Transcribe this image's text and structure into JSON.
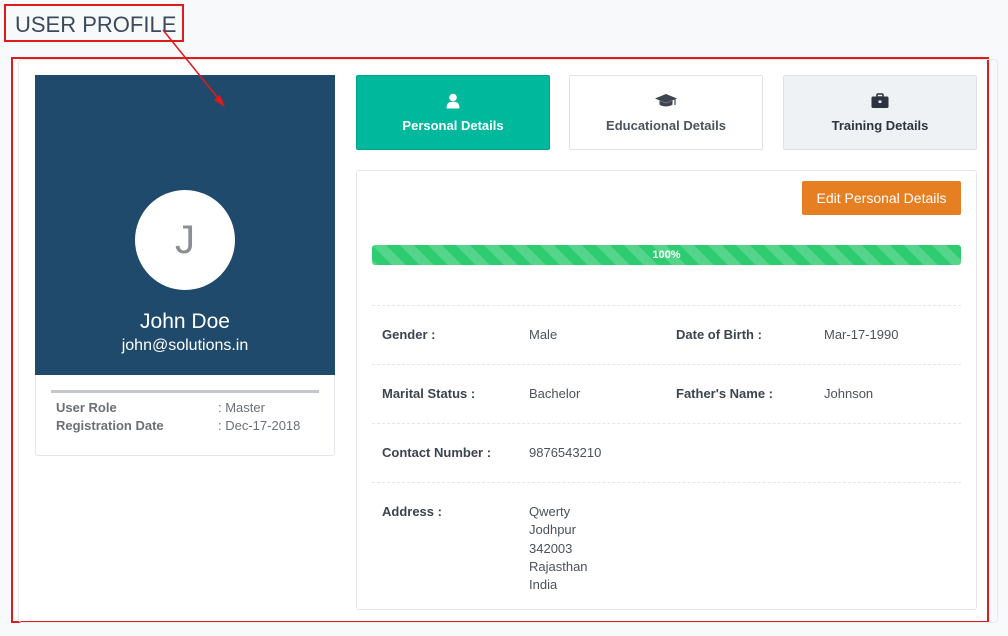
{
  "page_label": "USER PROFILE",
  "profile": {
    "avatar_initial": "J",
    "name": "John Doe",
    "email": "john@solutions.in",
    "meta": [
      {
        "key": "User Role",
        "value": ": Master"
      },
      {
        "key": "Registration Date",
        "value": ": Dec-17-2018"
      }
    ]
  },
  "tabs": [
    {
      "label": "Personal Details",
      "icon": "user-icon",
      "active": true
    },
    {
      "label": "Educational Details",
      "icon": "graduation-cap-icon",
      "active": false
    },
    {
      "label": "Training Details",
      "icon": "briefcase-icon",
      "active": false
    }
  ],
  "details": {
    "edit_label": "Edit Personal Details",
    "progress": {
      "value": 100,
      "label": "100%"
    },
    "gender_label": "Gender :",
    "gender": "Male",
    "dob_label": "Date of Birth :",
    "dob": "Mar-17-1990",
    "marital_label": "Marital Status :",
    "marital": "Bachelor",
    "father_label": "Father's Name :",
    "father": "Johnson",
    "contact_label": "Contact Number :",
    "contact": "9876543210",
    "address_label": "Address :",
    "address": [
      "Qwerty",
      "Jodhpur",
      "342003",
      "Rajasthan",
      "India"
    ]
  },
  "colors": {
    "banner": "#1f4a6b",
    "active_tab": "#00b89c",
    "edit_button": "#e67e22",
    "progress": "#2ecc71",
    "annotation": "#e01b1b"
  }
}
